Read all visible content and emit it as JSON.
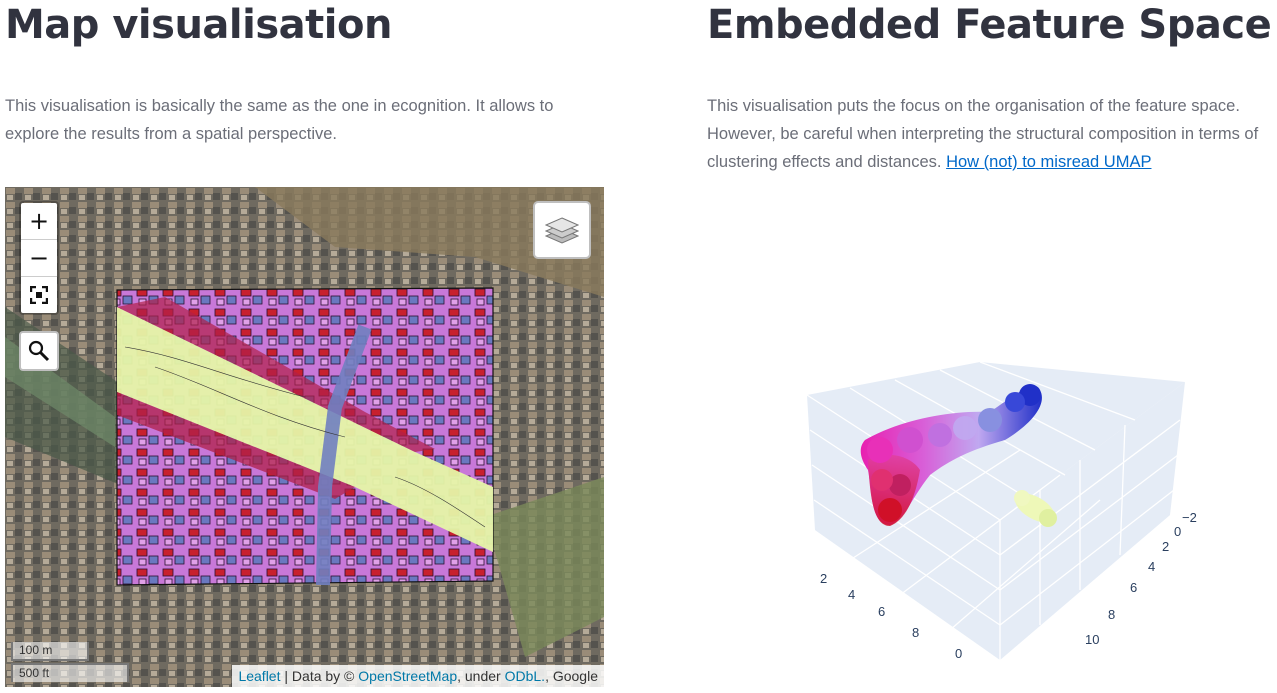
{
  "left": {
    "title": "Map visualisation",
    "description": "This visualisation is basically the same as the one in ecognition. It allows to explore the results from a spatial perspective."
  },
  "right": {
    "title": "Embedded Feature Space",
    "description": "This visualisation puts the focus on the organisation of the feature space. However, be careful when interpreting the structural composition in terms of clustering effects and distances.",
    "link_label": "How (not) to misread UMAP"
  },
  "map": {
    "zoom_in": "+",
    "zoom_out": "−",
    "scale_metric": "100 m",
    "scale_imperial": "500 ft",
    "attribution": {
      "leaflet": "Leaflet",
      "sep1": " | Data by © ",
      "osm": "OpenStreetMap",
      "under": ", under ",
      "odbl": "ODbL.",
      "google": ", Google"
    },
    "icons": [
      "zoom-in-icon",
      "zoom-out-icon",
      "fullscreen-icon",
      "search-icon",
      "layers-icon"
    ]
  },
  "plot": {
    "x_ticks": [
      "2",
      "4",
      "6",
      "8",
      "0"
    ],
    "y_ticks": [
      "10",
      "8",
      "6",
      "4",
      "2",
      "0",
      "−2"
    ],
    "colors": {
      "cluster_main_start": "#e0207a",
      "cluster_main_end": "#2030c8",
      "cluster_small": "#e6f5a8",
      "pane": "#e5ecf6",
      "grid": "#ffffff"
    }
  }
}
